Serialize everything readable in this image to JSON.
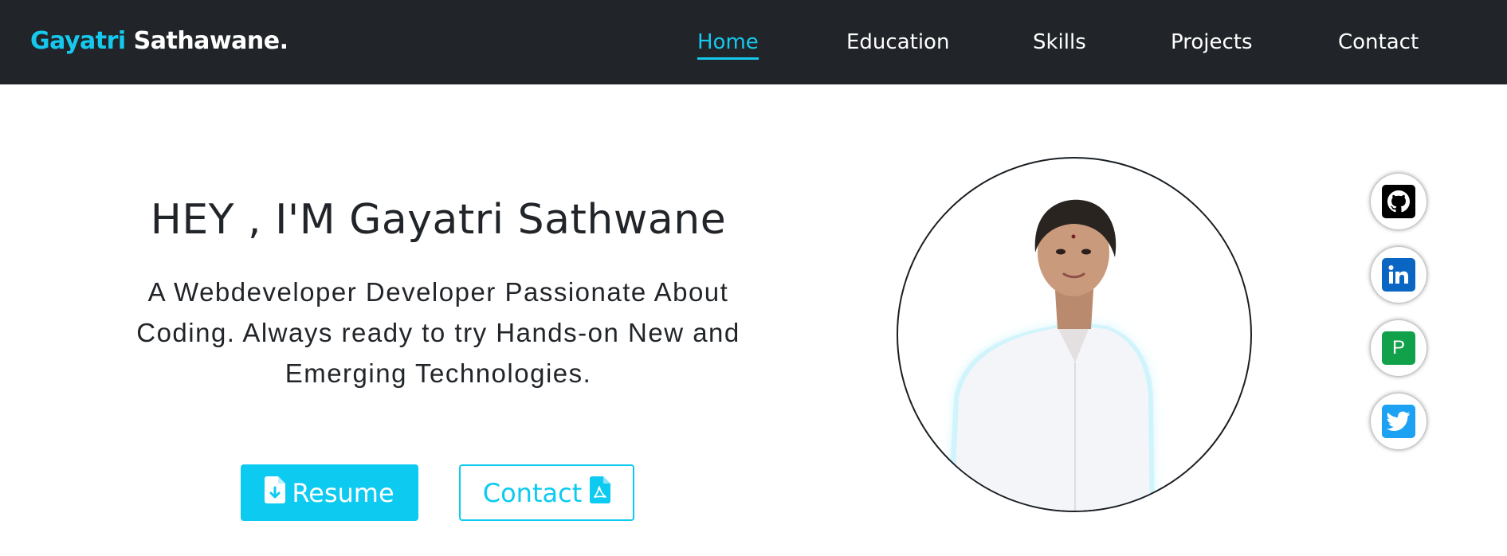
{
  "brand": {
    "first": "Gayatri",
    "last": "Sathawane."
  },
  "nav": {
    "items": [
      {
        "label": "Home",
        "active": true
      },
      {
        "label": "Education",
        "active": false
      },
      {
        "label": "Skills",
        "active": false
      },
      {
        "label": "Projects",
        "active": false
      },
      {
        "label": "Contact",
        "active": false
      }
    ]
  },
  "hero": {
    "title": "HEY , I'M Gayatri Sathwane",
    "subtitle": "A Webdeveloper Developer Passionate About Coding. Always ready to try Hands-on New and Emerging Technologies.",
    "resume_label": "Resume",
    "contact_label": "Contact",
    "resume_icon": "file-download-icon",
    "contact_icon": "file-pdf-icon"
  },
  "social": [
    {
      "name": "github-icon",
      "color": "#000000"
    },
    {
      "name": "linkedin-icon",
      "color": "#0a66c2"
    },
    {
      "name": "portfolio-p-icon",
      "label": "P",
      "color": "#12a14b"
    },
    {
      "name": "twitter-icon",
      "color": "#1da1f2"
    }
  ],
  "colors": {
    "accent": "#0dcaf0",
    "navbar": "#212529",
    "text": "#212529"
  }
}
